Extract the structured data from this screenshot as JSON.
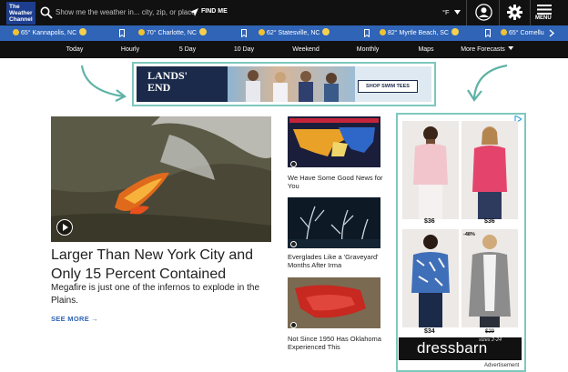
{
  "header": {
    "logo_line1": "The",
    "logo_line2": "Weather",
    "logo_line3": "Channel",
    "search_placeholder": "Show me the weather in... city, zip, or place",
    "find_me": "FIND ME",
    "unit": "°F",
    "menu_label": "MENU"
  },
  "locations": [
    {
      "label": "65° Kannapolis, NC"
    },
    {
      "label": "70° Charlotte, NC"
    },
    {
      "label": "62° Statesville, NC"
    },
    {
      "label": "82° Myrtle Beach, SC"
    },
    {
      "label": "65° Cornellu"
    }
  ],
  "nav": {
    "items": [
      "Today",
      "Hourly",
      "5 Day",
      "10 Day",
      "Weekend",
      "Monthly",
      "Maps",
      "More Forecasts"
    ]
  },
  "banner_ad": {
    "brand_line1": "LANDS'",
    "brand_line2": "END",
    "cta": "SHOP SWIM TEES"
  },
  "hero": {
    "headline": "Larger Than New York City and Only 15 Percent Contained",
    "summary": "Megafire is just one of the infernos to explode in the Plains.",
    "see_more": "SEE MORE"
  },
  "side_stories": [
    {
      "title": "We Have Some Good News for You"
    },
    {
      "title": "Everglades Like a 'Graveyard' Months After Irma"
    },
    {
      "title": "Not Since 1950 Has Oklahoma Experienced This"
    }
  ],
  "right_ad": {
    "prices": [
      "$36",
      "$36",
      "$34"
    ],
    "discount": "-48%",
    "old_price": "$29",
    "brand": "dressbarn",
    "tagline": "sizes 2-24",
    "label": "Advertisement"
  },
  "colors": {
    "topbar": "#111111",
    "location_strip": "#2f64b7",
    "accent_frame": "#7ec8be",
    "link": "#2f64b7"
  }
}
